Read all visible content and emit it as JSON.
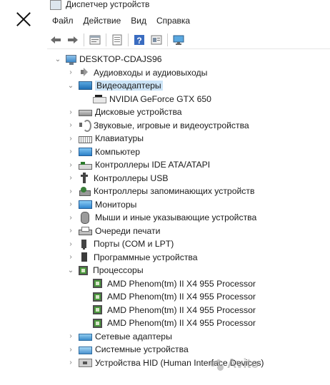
{
  "window": {
    "title": "Диспетчер устройств"
  },
  "menu": [
    "Файл",
    "Действие",
    "Вид",
    "Справка"
  ],
  "toolbar": [
    "back-icon",
    "forward-icon",
    "properties-icon",
    "list-icon",
    "help-icon",
    "view-icon",
    "monitor-icon"
  ],
  "tree": {
    "root": "DESKTOP-CDAJS96",
    "items": [
      {
        "label": "Аудиовходы и аудиовыходы",
        "icon": "audio-icon",
        "expanded": false
      },
      {
        "label": "Видеоадаптеры",
        "icon": "display-adapter-icon",
        "expanded": true,
        "selected": true,
        "children": [
          {
            "label": "NVIDIA GeForce GTX 650",
            "icon": "gpu-icon"
          }
        ]
      },
      {
        "label": "Дисковые устройства",
        "icon": "disk-icon",
        "expanded": false
      },
      {
        "label": "Звуковые, игровые и видеоустройства",
        "icon": "sound-icon",
        "expanded": false
      },
      {
        "label": "Клавиатуры",
        "icon": "keyboard-icon",
        "expanded": false
      },
      {
        "label": "Компьютер",
        "icon": "computer-icon",
        "expanded": false
      },
      {
        "label": "Контроллеры IDE ATA/ATAPI",
        "icon": "ide-icon",
        "expanded": false
      },
      {
        "label": "Контроллеры USB",
        "icon": "usb-icon",
        "expanded": false
      },
      {
        "label": "Контроллеры запоминающих устройств",
        "icon": "storage-icon",
        "expanded": false
      },
      {
        "label": "Мониторы",
        "icon": "monitor-icon",
        "expanded": false
      },
      {
        "label": "Мыши и иные указывающие устройства",
        "icon": "mouse-icon",
        "expanded": false
      },
      {
        "label": "Очереди печати",
        "icon": "printer-icon",
        "expanded": false
      },
      {
        "label": "Порты (COM и LPT)",
        "icon": "port-icon",
        "expanded": false
      },
      {
        "label": "Программные устройства",
        "icon": "software-icon",
        "expanded": false
      },
      {
        "label": "Процессоры",
        "icon": "cpu-icon",
        "expanded": true,
        "children": [
          {
            "label": "AMD Phenom(tm) II X4 955 Processor",
            "icon": "cpu-icon"
          },
          {
            "label": "AMD Phenom(tm) II X4 955 Processor",
            "icon": "cpu-icon"
          },
          {
            "label": "AMD Phenom(tm) II X4 955 Processor",
            "icon": "cpu-icon"
          },
          {
            "label": "AMD Phenom(tm) II X4 955 Processor",
            "icon": "cpu-icon"
          }
        ]
      },
      {
        "label": "Сетевые адаптеры",
        "icon": "network-icon",
        "expanded": false
      },
      {
        "label": "Системные устройства",
        "icon": "system-icon",
        "expanded": false
      },
      {
        "label": "Устройства HID (Human Interface Devices)",
        "icon": "hid-icon",
        "expanded": false
      }
    ]
  },
  "watermark": "Avito"
}
